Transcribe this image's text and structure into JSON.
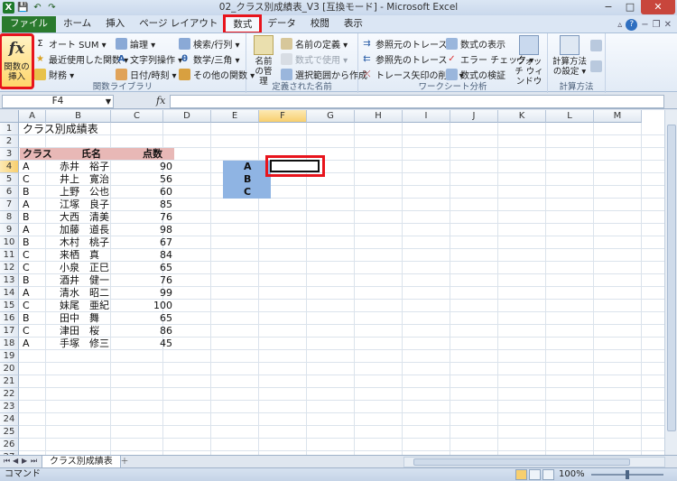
{
  "window": {
    "title": "02_クラス別成績表_V3 [互換モード] - Microsoft Excel",
    "minimize": "−",
    "maximize": "□",
    "close": "✕"
  },
  "quick_access": {
    "excel_logo": "X",
    "save": "💾",
    "undo": "↶",
    "redo": "↷"
  },
  "tabs": [
    {
      "label": "ファイル"
    },
    {
      "label": "ホーム"
    },
    {
      "label": "挿入"
    },
    {
      "label": "ページ レイアウト"
    },
    {
      "label": "数式",
      "active": true
    },
    {
      "label": "データ"
    },
    {
      "label": "校閲"
    },
    {
      "label": "表示"
    }
  ],
  "ribbon": {
    "function_library": {
      "label": "関数ライブラリ",
      "insert_function": "関数の挿入",
      "items": [
        "オート SUM ▾",
        "最近使用した関数 ▾",
        "財務 ▾",
        "論理 ▾",
        "文字列操作 ▾",
        "日付/時刻 ▾",
        "検索/行列 ▾",
        "数学/三角 ▾",
        "その他の関数 ▾"
      ]
    },
    "defined_names": {
      "label": "定義された名前",
      "name_manager": "名前の管理",
      "items": [
        "名前の定義 ▾",
        "数式で使用 ▾",
        "選択範囲から作成"
      ]
    },
    "formula_auditing": {
      "label": "ワークシート分析",
      "items": [
        "参照元のトレース",
        "参照先のトレース",
        "トレース矢印の削除 ▾",
        "数式の表示",
        "エラー チェック ▾",
        "数式の検証"
      ],
      "watch_window": "ウォッチ ウィンドウ"
    },
    "calculation": {
      "label": "計算方法",
      "options": "計算方法の設定 ▾"
    }
  },
  "formula_bar": {
    "name_box": "F4",
    "fx": "fx",
    "content": ""
  },
  "columns": [
    "A",
    "B",
    "C",
    "D",
    "E",
    "F",
    "G",
    "H",
    "I",
    "J",
    "K",
    "L",
    "M"
  ],
  "rows": [
    "1",
    "2",
    "3",
    "4",
    "5",
    "6",
    "7",
    "8",
    "9",
    "10",
    "11",
    "12",
    "13",
    "14",
    "15",
    "16",
    "17",
    "18",
    "19",
    "20",
    "21",
    "22",
    "23",
    "24",
    "25",
    "26",
    "27",
    "28"
  ],
  "sheet": {
    "title": "クラス別成績表",
    "headers": {
      "class": "クラス",
      "name": "氏名",
      "score": "点数"
    },
    "records": [
      {
        "class": "A",
        "name": "赤井　裕子",
        "score": "90"
      },
      {
        "class": "C",
        "name": "井上　寛治",
        "score": "56"
      },
      {
        "class": "B",
        "name": "上野　公也",
        "score": "60"
      },
      {
        "class": "A",
        "name": "江塚　良子",
        "score": "85"
      },
      {
        "class": "B",
        "name": "大西　清美",
        "score": "76"
      },
      {
        "class": "A",
        "name": "加藤　道長",
        "score": "98"
      },
      {
        "class": "B",
        "name": "木村　桃子",
        "score": "67"
      },
      {
        "class": "C",
        "name": "来栖　真",
        "score": "84"
      },
      {
        "class": "C",
        "name": "小泉　正巳",
        "score": "65"
      },
      {
        "class": "B",
        "name": "酒井　健一",
        "score": "76"
      },
      {
        "class": "A",
        "name": "清水　昭二",
        "score": "99"
      },
      {
        "class": "C",
        "name": "妹尾　亜紀",
        "score": "100"
      },
      {
        "class": "B",
        "name": "田中　舞",
        "score": "65"
      },
      {
        "class": "C",
        "name": "津田　桜",
        "score": "86"
      },
      {
        "class": "A",
        "name": "手塚　修三",
        "score": "45"
      }
    ],
    "summary_labels": [
      "A",
      "B",
      "C"
    ]
  },
  "sheet_tabs": {
    "active": "クラス別成績表"
  },
  "status": {
    "mode": "コマンド",
    "zoom": "100%"
  },
  "colors": {
    "highlight_red": "#e8141c",
    "header_band": "#e8b8b6",
    "summary_band": "#8fb4e3",
    "file_tab": "#2a7a2e"
  }
}
